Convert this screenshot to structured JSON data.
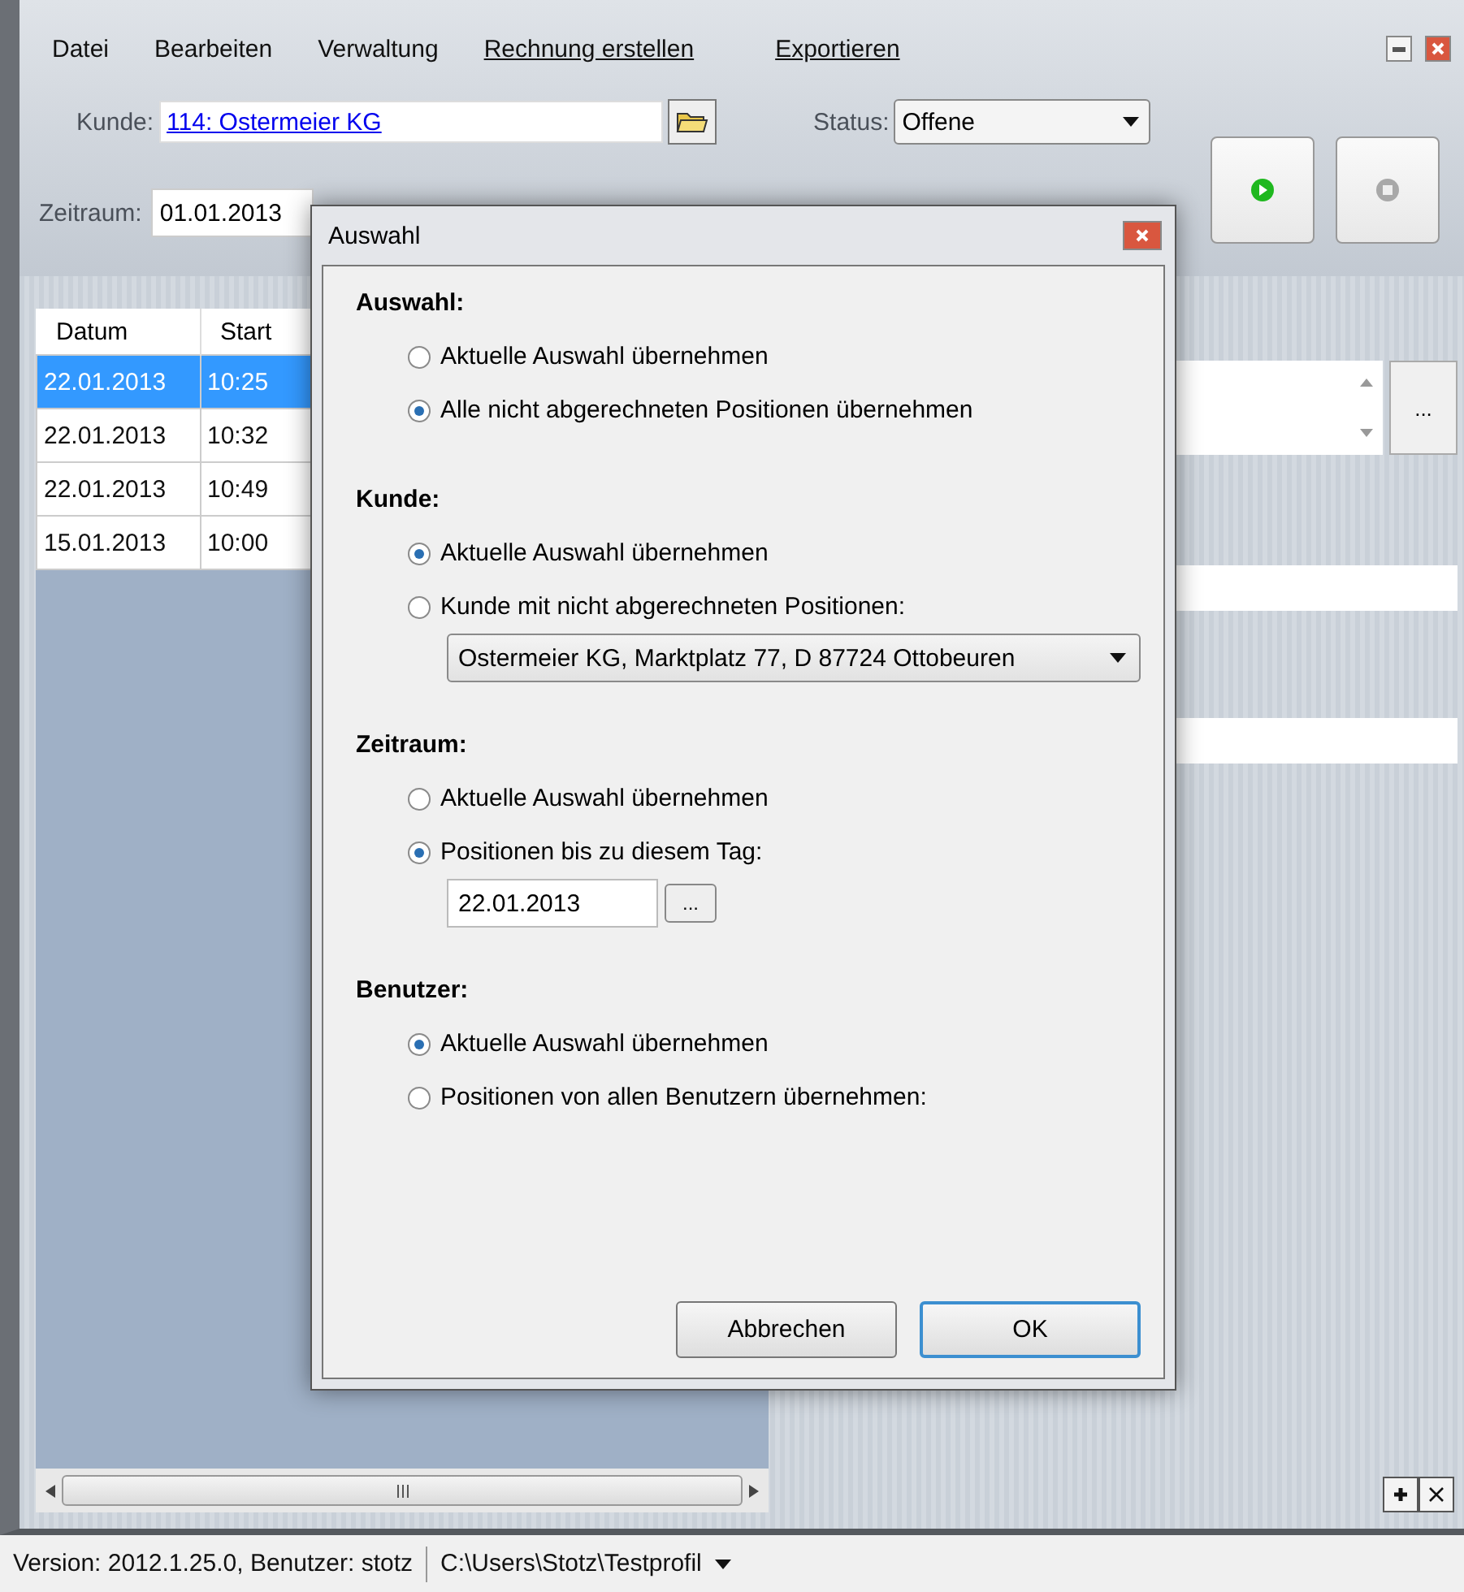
{
  "menu": [
    {
      "label": "Datei",
      "kind": "plain"
    },
    {
      "label": "Bearbeiten",
      "kind": "plain"
    },
    {
      "label": "Verwaltung",
      "kind": "plain"
    },
    {
      "label": "Rechnung erstellen",
      "kind": "link"
    },
    {
      "label": "Exportieren",
      "kind": "link"
    }
  ],
  "customer": {
    "label": "Kunde:",
    "value": "114: Ostermeier KG"
  },
  "status": {
    "label": "Status:",
    "value": "Offene"
  },
  "period": {
    "label": "Zeitraum:",
    "value": "01.01.2013"
  },
  "table": {
    "columns": [
      "Datum",
      "Start"
    ],
    "rows": [
      {
        "cells": [
          "22.01.2013",
          "10:25"
        ],
        "selected": true
      },
      {
        "cells": [
          "22.01.2013",
          "10:32"
        ],
        "selected": false
      },
      {
        "cells": [
          "22.01.2013",
          "10:49"
        ],
        "selected": false
      },
      {
        "cells": [
          "15.01.2013",
          "10:00"
        ],
        "selected": false
      }
    ]
  },
  "side_button": "...",
  "status_bar": {
    "info": "Version: 2012.1.25.0, Benutzer: stotz",
    "profile": "C:\\Users\\Stotz\\Testprofil"
  },
  "dialog": {
    "title": "Auswahl",
    "sections": [
      {
        "heading": "Auswahl:",
        "options": [
          {
            "label": "Aktuelle Auswahl übernehmen",
            "selected": false
          },
          {
            "label": "Alle nicht abgerechneten Positionen übernehmen",
            "selected": true
          }
        ]
      },
      {
        "heading": "Kunde:",
        "options": [
          {
            "label": "Aktuelle Auswahl übernehmen",
            "selected": true
          },
          {
            "label": "Kunde mit nicht abgerechneten Positionen:",
            "selected": false
          }
        ],
        "extra": {
          "kind": "dropdown",
          "value": "Ostermeier KG, Marktplatz 77, D 87724 Ottobeuren"
        }
      },
      {
        "heading": "Zeitraum:",
        "options": [
          {
            "label": "Aktuelle Auswahl übernehmen",
            "selected": false
          },
          {
            "label": "Positionen bis zu diesem Tag:",
            "selected": true
          }
        ],
        "extra": {
          "kind": "date",
          "value": "22.01.2013",
          "button": "..."
        }
      },
      {
        "heading": "Benutzer:",
        "options": [
          {
            "label": "Aktuelle Auswahl übernehmen",
            "selected": true
          },
          {
            "label": "Positionen von allen Benutzern übernehmen:",
            "selected": false
          }
        ]
      }
    ],
    "buttons": [
      {
        "label": "Abbrechen",
        "default": false
      },
      {
        "label": "OK",
        "default": true
      }
    ]
  }
}
